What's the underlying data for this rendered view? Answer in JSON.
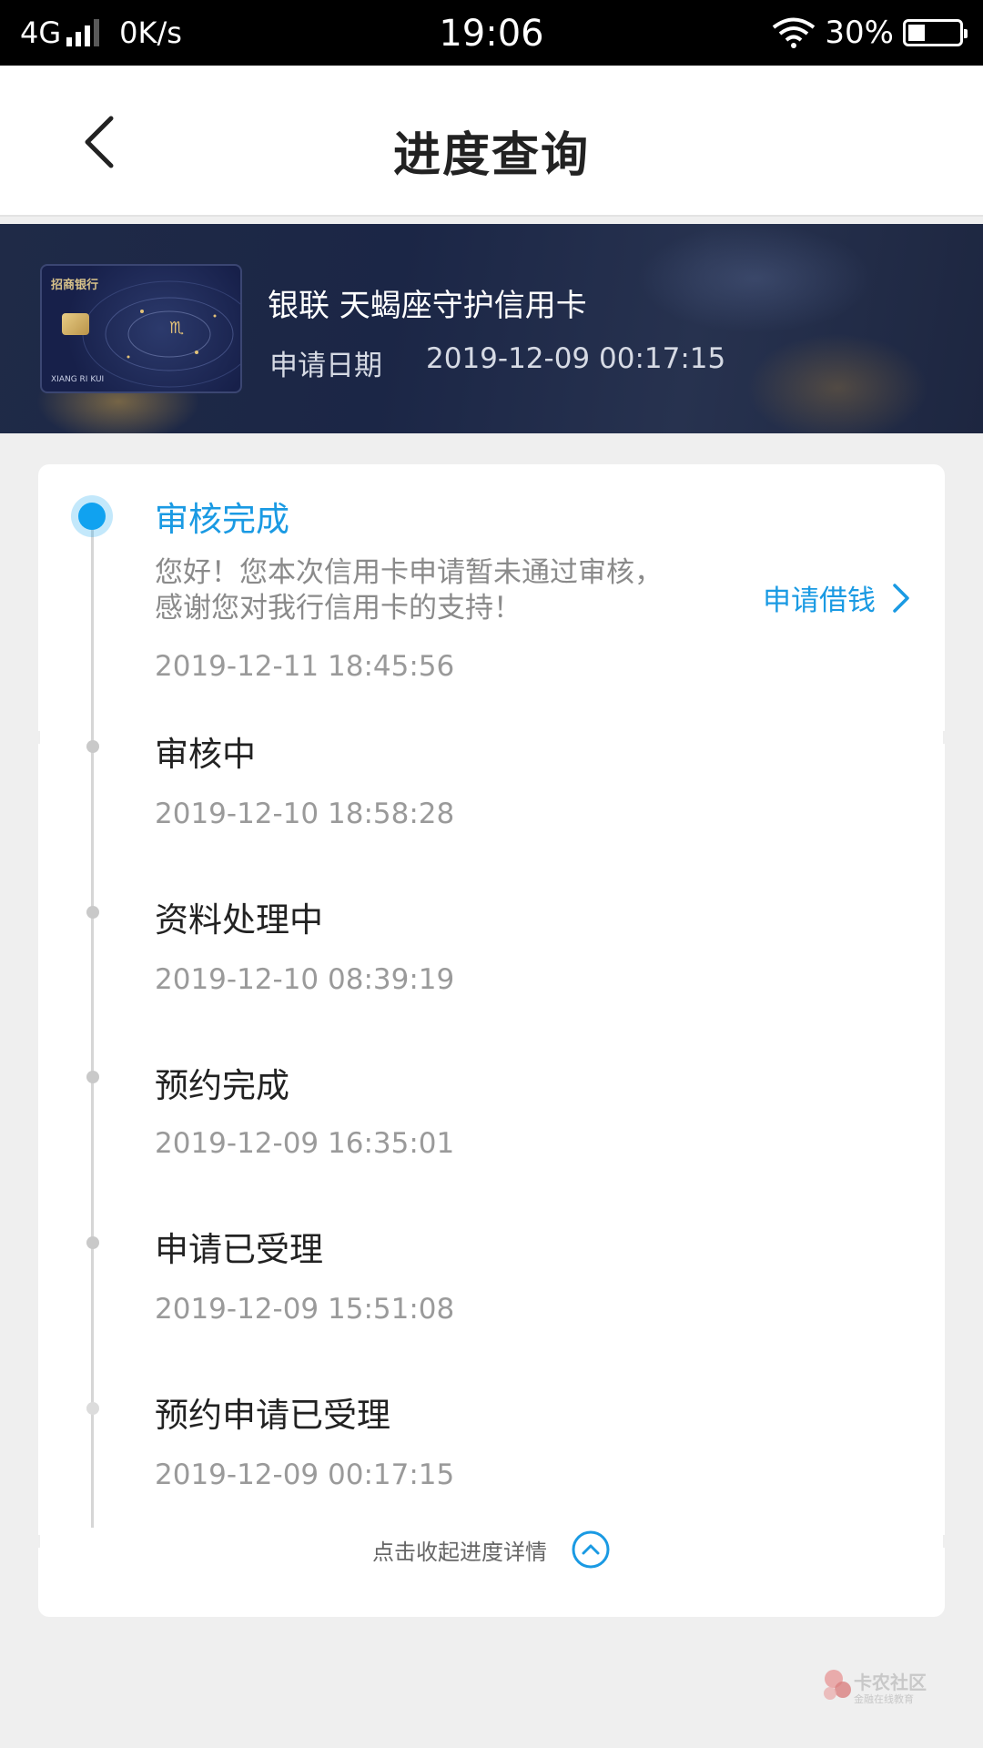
{
  "status_bar": {
    "network": "4G",
    "speed": "0K/s",
    "time": "19:06",
    "battery": "30%"
  },
  "header": {
    "title": "进度查询"
  },
  "card": {
    "name": "银联 天蝎座守护信用卡",
    "date_label": "申请日期",
    "date_value": "2019-12-09 00:17:15",
    "image_bank": "招商银行",
    "image_name": "XIANG RI KUI"
  },
  "timeline": {
    "current": {
      "title": "审核完成",
      "description": "您好！您本次信用卡申请暂未通过审核，感谢您对我行信用卡的支持！",
      "time": "2019-12-11 18:45:56",
      "action": "申请借钱"
    },
    "steps": [
      {
        "title": "审核中",
        "time": "2019-12-10 18:58:28"
      },
      {
        "title": "资料处理中",
        "time": "2019-12-10 08:39:19"
      },
      {
        "title": "预约完成",
        "time": "2019-12-09 16:35:01"
      },
      {
        "title": "申请已受理",
        "time": "2019-12-09 15:51:08"
      },
      {
        "title": "预约申请已受理",
        "time": "2019-12-09 00:17:15"
      }
    ]
  },
  "collapse_label": "点击收起进度详情",
  "watermark": {
    "title": "卡农社区",
    "subtitle": "金融在线教育"
  },
  "colors": {
    "accent": "#1a9ae3",
    "banner": "#1f2a47"
  }
}
